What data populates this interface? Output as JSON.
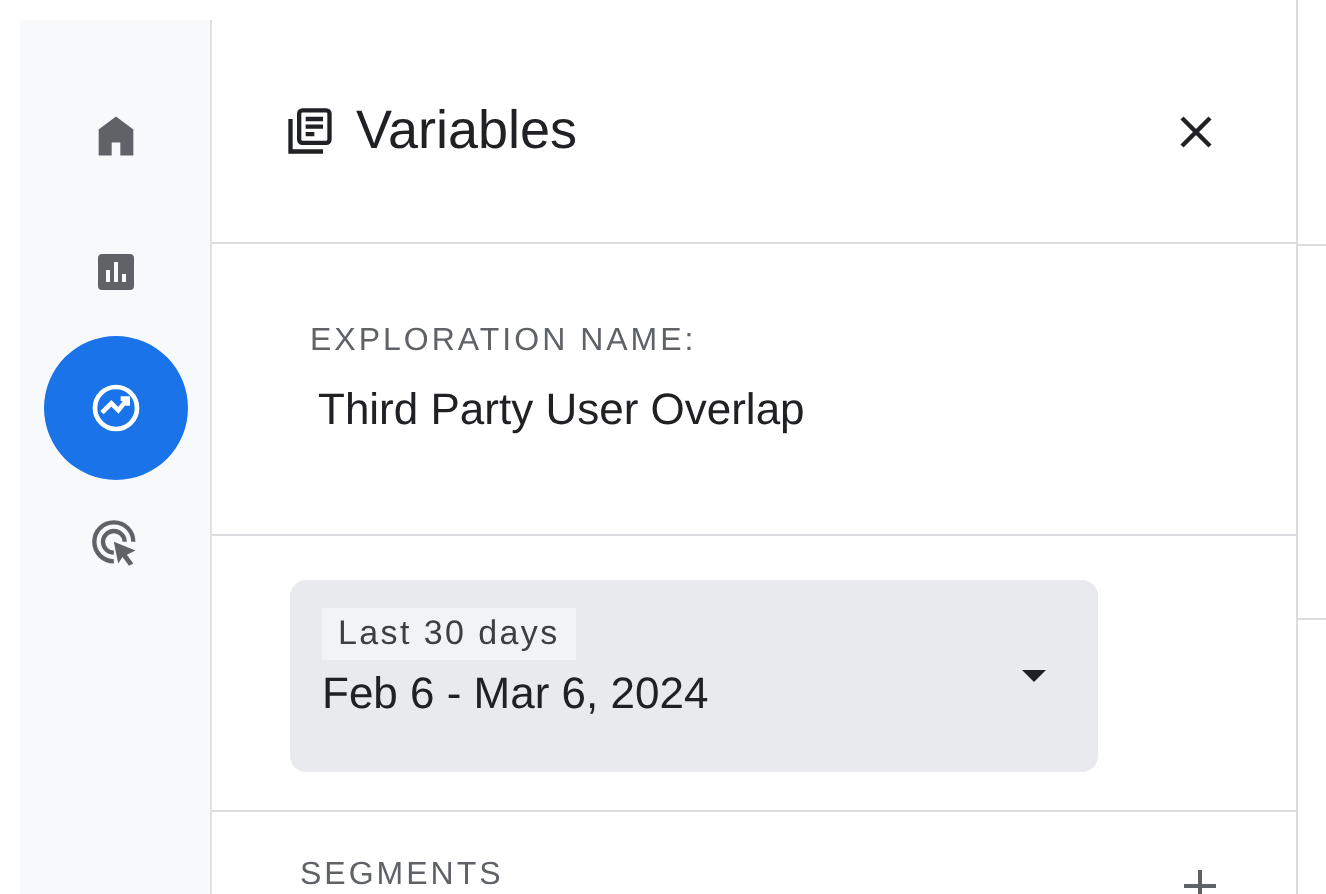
{
  "nav": [
    {
      "kind": "home",
      "selected": false
    },
    {
      "kind": "reports",
      "selected": false
    },
    {
      "kind": "explore",
      "selected": true
    },
    {
      "kind": "advertising",
      "selected": false
    }
  ],
  "panel": {
    "title": "Variables",
    "name_label": "EXPLORATION NAME:",
    "name_value": "Third Party User Overlap",
    "date_range": {
      "preset": "Last 30 days",
      "range": "Feb 6 - Mar 6, 2024"
    },
    "segments_label": "SEGMENTS"
  }
}
